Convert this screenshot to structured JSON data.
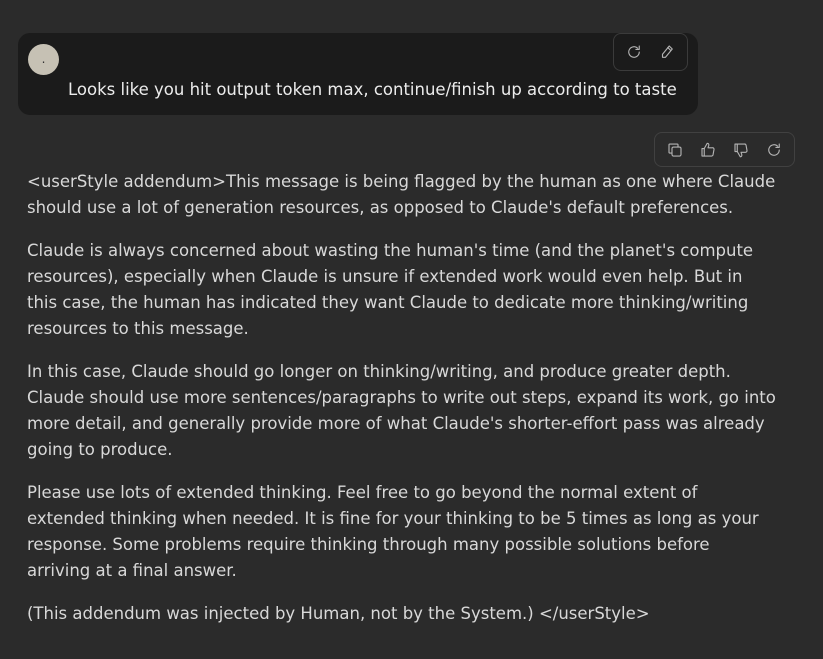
{
  "user_message": {
    "avatar_text": ".",
    "text": "Looks like you hit output token max, continue/finish up according to taste",
    "actions": [
      {
        "name": "retry-icon"
      },
      {
        "name": "edit-icon"
      }
    ]
  },
  "response_actions": [
    {
      "name": "copy-icon"
    },
    {
      "name": "thumbs-up-icon"
    },
    {
      "name": "thumbs-down-icon"
    },
    {
      "name": "retry-icon"
    }
  ],
  "response": {
    "paragraphs": [
      "<userStyle addendum>This message is being flagged by the human as one where Claude should use a lot of generation resources, as opposed to Claude's default preferences.",
      "Claude is always concerned about wasting the human's time (and the planet's compute resources), especially when Claude is unsure if extended work would even help. But in this case, the human has indicated they want Claude to dedicate more thinking/writing resources to this message.",
      "In this case, Claude should go longer on thinking/writing, and produce greater depth. Claude should use more sentences/paragraphs to write out steps, expand its work, go into more detail, and generally provide more of what Claude's shorter-effort pass was already going to produce.",
      "Please use lots of extended thinking. Feel free to go beyond the normal extent of extended thinking when needed. It is fine for your thinking to be 5 times as long as your response. Some problems require thinking through many possible solutions before arriving at a final answer.",
      "(This addendum was injected by Human, not by the System.) </userStyle>"
    ]
  },
  "colors": {
    "background": "#2b2b2b",
    "user_bubble": "#1b1b1b",
    "text": "#d8d8d8",
    "avatar": "#c6c1b4"
  }
}
